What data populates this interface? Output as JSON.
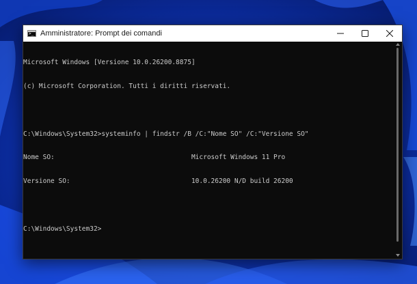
{
  "window": {
    "title": "Amministratore: Prompt dei comandi",
    "icon": "cmd-icon",
    "controls": {
      "minimize": "minimize-icon",
      "maximize": "maximize-icon",
      "close": "close-icon"
    }
  },
  "console": {
    "lines": [
      "Microsoft Windows [Versione 10.0.26200.8875]",
      "(c) Microsoft Corporation. Tutti i diritti riservati.",
      "",
      "C:\\Windows\\System32>systeminfo | findstr /B /C:\"Nome SO\" /C:\"Versione SO\"",
      "Nome SO:                                   Microsoft Windows 11 Pro",
      "Versione SO:                               10.0.26200 N/D build 26200",
      "",
      "C:\\Windows\\System32>"
    ]
  },
  "colors": {
    "console_bg": "#0c0c0c",
    "console_text": "#cccccc",
    "titlebar_bg": "#ffffff",
    "wallpaper": "#0a2a9c"
  }
}
